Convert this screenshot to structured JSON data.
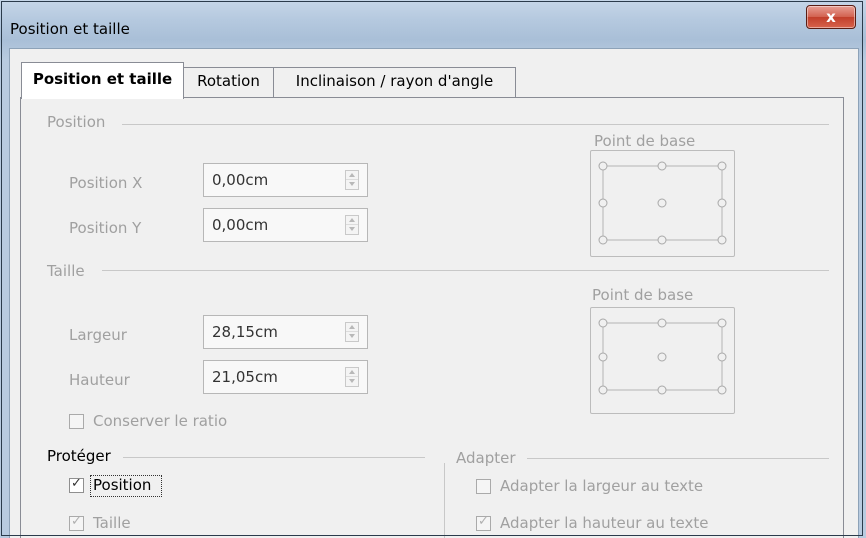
{
  "window": {
    "title": "Position et taille",
    "close_label": "x"
  },
  "tabs": [
    {
      "label": "Position et taille",
      "active": true
    },
    {
      "label": "Rotation",
      "active": false
    },
    {
      "label": "Inclinaison / rayon d'angle",
      "active": false
    }
  ],
  "position": {
    "heading": "Position",
    "x": {
      "label": "Position X",
      "value": "0,00cm"
    },
    "y": {
      "label": "Position Y",
      "value": "0,00cm"
    },
    "base_point": {
      "label": "Point de base"
    }
  },
  "size": {
    "heading": "Taille",
    "width": {
      "label": "Largeur",
      "value": "28,15cm"
    },
    "height": {
      "label": "Hauteur",
      "value": "21,05cm"
    },
    "base_point": {
      "label": "Point de base"
    },
    "keep_ratio": {
      "label": "Conserver le ratio",
      "checked": false
    }
  },
  "protect": {
    "heading": "Protéger",
    "position": {
      "label": "Position",
      "checked": true
    },
    "size": {
      "label": "Taille",
      "checked": true
    }
  },
  "adapt": {
    "heading": "Adapter",
    "fit_width": {
      "label": "Adapter la largeur au texte",
      "checked": false
    },
    "fit_height": {
      "label": "Adapter la hauteur au texte",
      "checked": true
    }
  },
  "colors": {
    "title_bar": "#b5c9df",
    "close_button": "#c13f2b",
    "disabled_text": "#a0a0a0"
  },
  "icons": {
    "spin": "spin-button-icon",
    "check": "checkmark-icon",
    "radio": "radio-icon"
  }
}
